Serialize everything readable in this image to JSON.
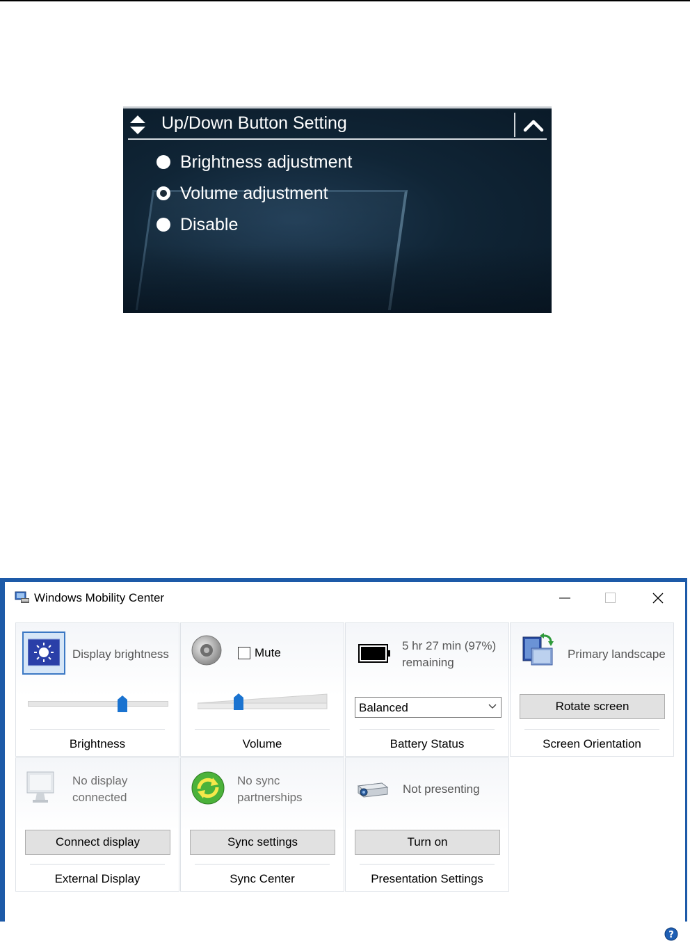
{
  "updown_panel": {
    "title": "Up/Down Button Setting",
    "options": [
      {
        "label": "Brightness adjustment",
        "selected": false
      },
      {
        "label": "Volume adjustment",
        "selected": true
      },
      {
        "label": "Disable",
        "selected": false
      }
    ],
    "icons": {
      "header": "up-down-arrows-icon",
      "collapse": "chevron-up-icon"
    }
  },
  "mobility_center": {
    "window_title": "Windows Mobility Center",
    "accent_color": "#1d5aa8",
    "tiles": {
      "brightness": {
        "status": "Display brightness",
        "label": "Brightness",
        "slider_level": 0.69,
        "icon": "brightness-sun-icon"
      },
      "volume": {
        "mute_label": "Mute",
        "muted": false,
        "label": "Volume",
        "slider_level": 0.3,
        "icon": "speaker-icon"
      },
      "battery": {
        "status": "5 hr 27 min (97%) remaining",
        "power_plan": "Balanced",
        "label": "Battery Status",
        "charge_percent": 97,
        "icon": "battery-icon"
      },
      "orientation": {
        "status": "Primary landscape",
        "button": "Rotate screen",
        "label": "Screen Orientation",
        "icon": "rotate-screen-icon"
      },
      "external_display": {
        "status": "No display connected",
        "button": "Connect display",
        "label": "External Display",
        "icon": "monitor-icon"
      },
      "sync": {
        "status": "No sync partnerships",
        "button": "Sync settings",
        "label": "Sync Center",
        "icon": "sync-arrows-icon"
      },
      "presentation": {
        "status": "Not presenting",
        "button": "Turn on",
        "label": "Presentation Settings",
        "icon": "projector-icon"
      }
    }
  }
}
